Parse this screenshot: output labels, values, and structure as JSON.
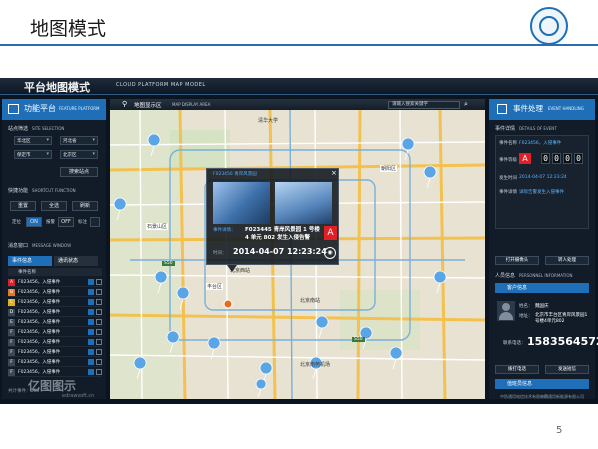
{
  "slide": {
    "title": "地图模式",
    "page_number": "5",
    "watermark": "亿图图示",
    "watermark_sub": "edrawsoft.cn"
  },
  "app": {
    "title": "平台地图模式",
    "subtitle": "CLOUD PLATFORM MAP MODEL"
  },
  "left_panel": {
    "title": "功能平台",
    "title_en": "FEATURE PLATFORM",
    "site_selection": {
      "label": "站点筛选",
      "label_en": "SITE SELECTION"
    },
    "selects": [
      {
        "value": "华北区"
      },
      {
        "value": "河北省"
      },
      {
        "value": "保定市"
      },
      {
        "value": "北京区"
      }
    ],
    "search_label": "搜索站点",
    "shortcut": {
      "label": "快捷功能",
      "label_en": "SHORTCUT FUNCTION"
    },
    "shortcut_buttons": [
      {
        "label": "重置"
      },
      {
        "label": "全选"
      },
      {
        "label": "刷新"
      }
    ],
    "toggles": [
      {
        "label": "定位",
        "state": "ON"
      },
      {
        "label": "报警",
        "state": "OFF"
      },
      {
        "label": "标注",
        "state": ""
      }
    ],
    "message": {
      "label": "消息窗口",
      "label_en": "MESSAGE WINDOW"
    },
    "tabs": [
      {
        "label": "事件信息",
        "active": true
      },
      {
        "label": "通讯状态",
        "active": false
      }
    ],
    "events_header": "事件名称",
    "events": [
      {
        "code": "A",
        "text": "F023456，入侵事件",
        "color": "#e21e26"
      },
      {
        "code": "B",
        "text": "F023456，入侵事件",
        "color": "#e87722"
      },
      {
        "code": "C",
        "text": "F023456，入侵事件",
        "color": "#e0b21a"
      },
      {
        "code": "D",
        "text": "F023456，入侵事件",
        "color": "#3a4756"
      },
      {
        "code": "E",
        "text": "F023456，入侵事件",
        "color": "#3a4756"
      },
      {
        "code": "F",
        "text": "F023456，入侵事件",
        "color": "#3a4756"
      },
      {
        "code": "F",
        "text": "F023456，入侵事件",
        "color": "#3a4756"
      },
      {
        "code": "F",
        "text": "F023456，入侵事件",
        "color": "#3a4756"
      },
      {
        "code": "F",
        "text": "F023456，入侵事件",
        "color": "#3a4756"
      },
      {
        "code": "F",
        "text": "F023456，入侵事件",
        "color": "#3a4756"
      }
    ],
    "footer": "共计事件：168"
  },
  "map": {
    "title": "地图显示区",
    "title_en": "MAP DISPLAY AREA",
    "search_placeholder": "请输入搜索关键字",
    "labels": [
      {
        "text": "清华大学"
      },
      {
        "text": "朝阳区"
      },
      {
        "text": "石景山区"
      },
      {
        "text": "丰台区"
      },
      {
        "text": "北京南站"
      },
      {
        "text": "北京南苑机场"
      },
      {
        "text": "北京西站"
      }
    ],
    "shields": [
      "S50",
      "S50"
    ],
    "popup": {
      "title": "F023456 青岸风景园",
      "image_label": "事件详情：",
      "description": "F023445 青岸风景园 1 号楼 4 单元 802 发生入侵告警",
      "level": "A",
      "time_label": "时间：",
      "time": "2014-04-07  12:23:24"
    }
  },
  "right_panel": {
    "title": "事件处理",
    "title_en": "EVENT HANDLING",
    "details": {
      "label": "事件详情",
      "label_en": "DETAILS OF EVENT"
    },
    "event_name_key": "事件名称",
    "event_name_val": "F023456，入侵事件",
    "level_key": "事件等级",
    "level": "A",
    "code_digits": [
      "0",
      "0",
      "0",
      "0"
    ],
    "time_key": "发生时间",
    "time_val": "2014-04-07  12:23:24",
    "detail_key": "事件详情",
    "detail_val": "详际告警发生入侵事件",
    "buttons": [
      {
        "label": "打开摄像头"
      },
      {
        "label": "转人处理"
      }
    ],
    "personnel": {
      "label": "人员信息",
      "label_en": "PERSONNEL INFORMATION"
    },
    "customer_label": "客户信息",
    "name_key": "姓名：",
    "name_val": "魏国庆",
    "addr_key": "地址：",
    "addr_val": "北京市丰台区青岸风景园1号楼4单元802",
    "phone_key": "联系电话：",
    "phone": "15835645726",
    "call_buttons": [
      {
        "label": "拨打电话"
      },
      {
        "label": "发送短信"
      }
    ],
    "staff_label": "值班员信息",
    "footer_left": "中防通用电信技术有限公司",
    "footer_right": "中防通用新能源有限公司"
  },
  "colors": {
    "accent": "#1e6fb8",
    "alarm": "#e21e26",
    "panel": "#111c28"
  }
}
